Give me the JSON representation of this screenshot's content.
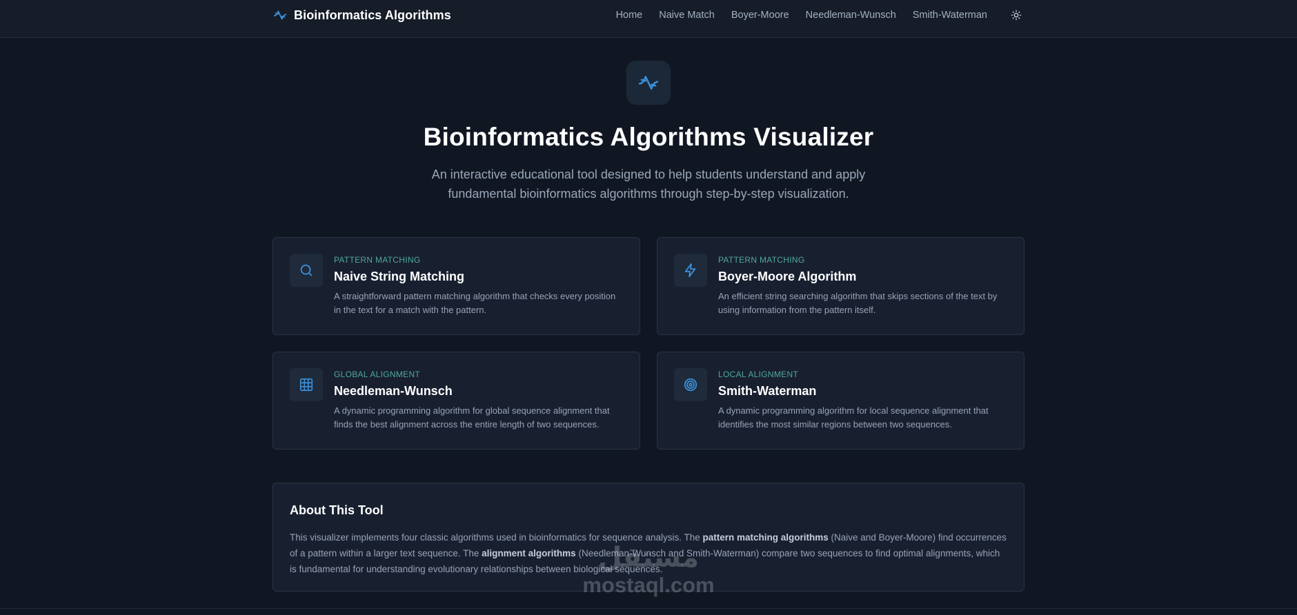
{
  "header": {
    "brand_title": "Bioinformatics Algorithms",
    "nav": [
      "Home",
      "Naive Match",
      "Boyer-Moore",
      "Needleman-Wunsch",
      "Smith-Waterman"
    ],
    "theme_icon": "sun-icon"
  },
  "hero": {
    "icon": "dna-icon",
    "title": "Bioinformatics Algorithms Visualizer",
    "subtitle": "An interactive educational tool designed to help students understand and apply fundamental bioinformatics algorithms through step-by-step visualization."
  },
  "cards": [
    {
      "icon": "search-icon",
      "category": "PATTERN MATCHING",
      "title": "Naive String Matching",
      "description": "A straightforward pattern matching algorithm that checks every position in the text for a match with the pattern."
    },
    {
      "icon": "lightning-icon",
      "category": "PATTERN MATCHING",
      "title": "Boyer-Moore Algorithm",
      "description": "An efficient string searching algorithm that skips sections of the text by using information from the pattern itself."
    },
    {
      "icon": "grid-icon",
      "category": "GLOBAL ALIGNMENT",
      "title": "Needleman-Wunsch",
      "description": "A dynamic programming algorithm for global sequence alignment that finds the best alignment across the entire length of two sequences."
    },
    {
      "icon": "target-icon",
      "category": "LOCAL ALIGNMENT",
      "title": "Smith-Waterman",
      "description": "A dynamic programming algorithm for local sequence alignment that identifies the most similar regions between two sequences."
    }
  ],
  "about": {
    "title": "About This Tool",
    "text_1": "This visualizer implements four classic algorithms used in bioinformatics for sequence analysis. The ",
    "bold_1": "pattern matching algorithms",
    "text_2": " (Naive and Boyer-Moore) find occurrences of a pattern within a larger text sequence. The ",
    "bold_2": "alignment algorithms",
    "text_3": " (Needleman-Wunsch and Smith-Waterman) compare two sequences to find optimal alignments, which is fundamental for understanding evolutionary relationships between biological sequences."
  },
  "watermark": {
    "arabic": "مستقل",
    "latin": "mostaql.com"
  },
  "colors": {
    "background": "#111722",
    "panel": "#182030",
    "accent_blue": "#3b8fd9",
    "category_teal": "#4fa99d"
  }
}
